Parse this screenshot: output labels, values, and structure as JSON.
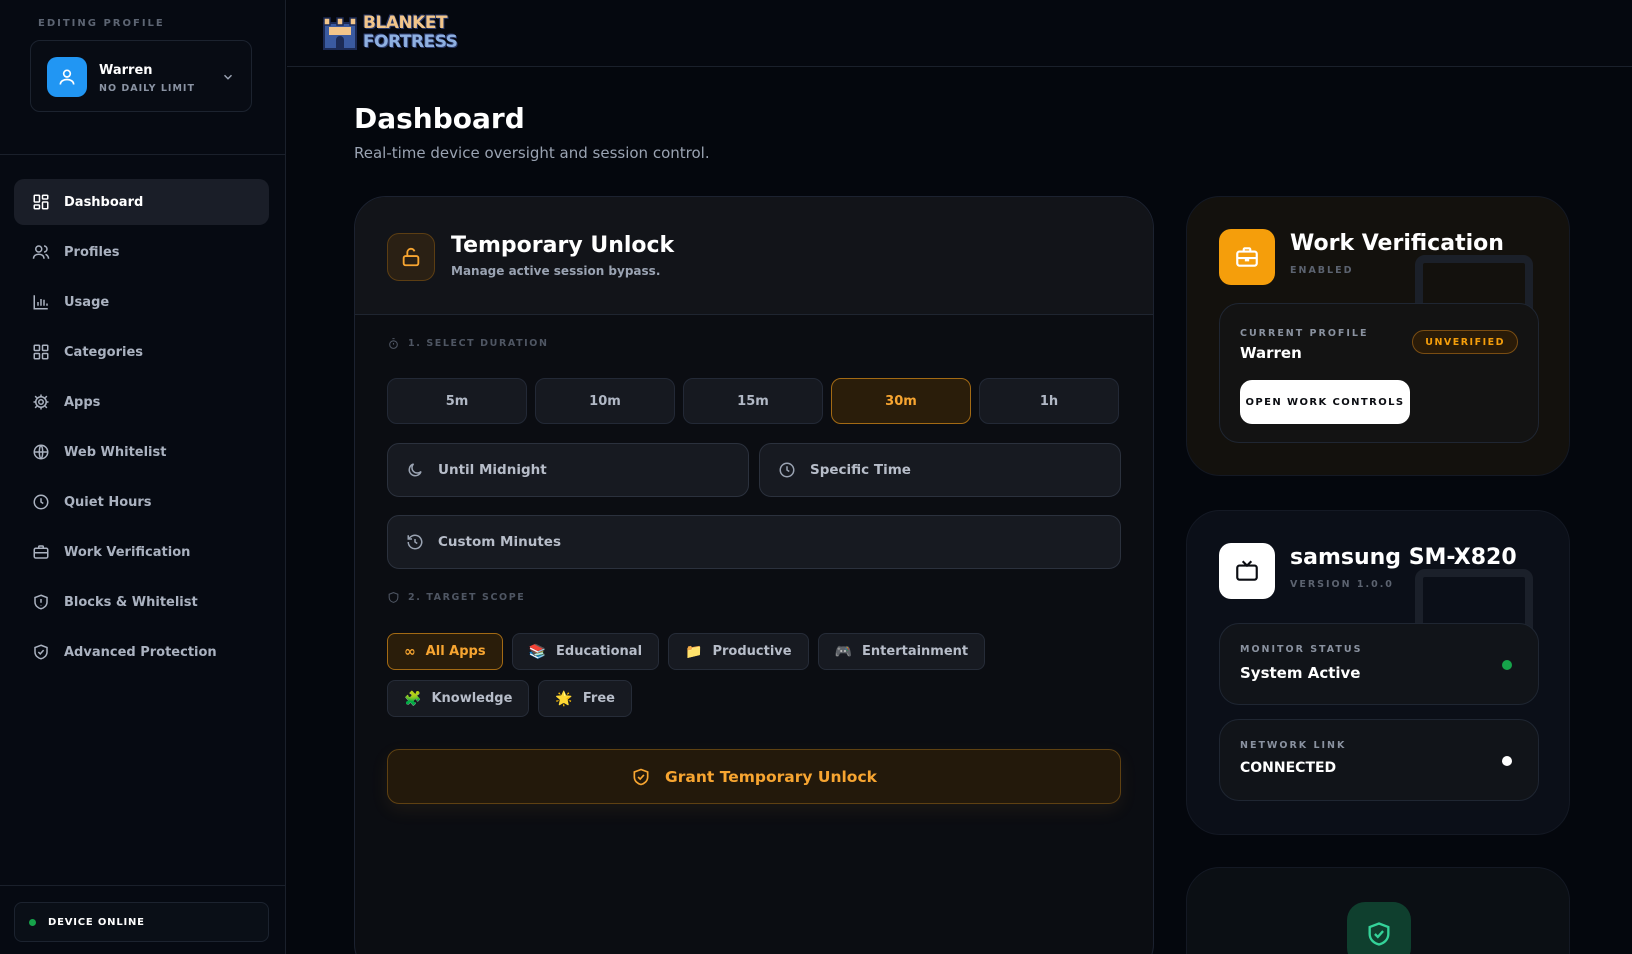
{
  "sidebar": {
    "editing_label": "EDITING PROFILE",
    "profile": {
      "name": "Warren",
      "limit": "NO DAILY LIMIT"
    },
    "items": [
      {
        "label": "Dashboard",
        "icon": "grid-icon"
      },
      {
        "label": "Profiles",
        "icon": "users-icon"
      },
      {
        "label": "Usage",
        "icon": "bar-chart-icon"
      },
      {
        "label": "Categories",
        "icon": "grid-icon"
      },
      {
        "label": "Apps",
        "icon": "gear-icon"
      },
      {
        "label": "Web Whitelist",
        "icon": "globe-icon"
      },
      {
        "label": "Quiet Hours",
        "icon": "clock-icon"
      },
      {
        "label": "Work Verification",
        "icon": "briefcase-icon"
      },
      {
        "label": "Blocks & Whitelist",
        "icon": "shield-alert-icon"
      },
      {
        "label": "Advanced Protection",
        "icon": "shield-check-icon"
      }
    ],
    "device_status": "DEVICE ONLINE"
  },
  "header": {
    "logo_line1": "BLANKET",
    "logo_line2": "FORTRESS"
  },
  "main": {
    "title": "Dashboard",
    "subtitle": "Real-time device oversight and session control."
  },
  "unlock": {
    "title": "Temporary Unlock",
    "subtitle": "Manage active session bypass.",
    "duration_label": "1. SELECT DURATION",
    "durations": [
      "5m",
      "10m",
      "15m",
      "30m",
      "1h"
    ],
    "active_duration": "30m",
    "until_midnight": "Until Midnight",
    "specific_time": "Specific Time",
    "custom_minutes": "Custom Minutes",
    "scope_label": "2. TARGET SCOPE",
    "scopes": [
      {
        "label": "All Apps",
        "emoji": "∞"
      },
      {
        "label": "Educational",
        "emoji": "📚"
      },
      {
        "label": "Productive",
        "emoji": "📁"
      },
      {
        "label": "Entertainment",
        "emoji": "🎮"
      },
      {
        "label": "Knowledge",
        "emoji": "🧩"
      },
      {
        "label": "Free",
        "emoji": "🌟"
      }
    ],
    "grant": "Grant Temporary Unlock"
  },
  "work": {
    "title": "Work Verification",
    "status": "ENABLED",
    "profile_label": "CURRENT PROFILE",
    "profile_name": "Warren",
    "badge": "UNVERIFIED",
    "open_button": "OPEN WORK CONTROLS"
  },
  "device": {
    "title": "samsung SM-X820",
    "version": "VERSION 1.0.0",
    "monitor_label": "MONITOR STATUS",
    "monitor_value": "System Active",
    "network_label": "NETWORK LINK",
    "network_value": "CONNECTED"
  },
  "colors": {
    "accent": "#f7a531",
    "profile_blue": "#2196f3",
    "online_green": "#16a34a"
  }
}
